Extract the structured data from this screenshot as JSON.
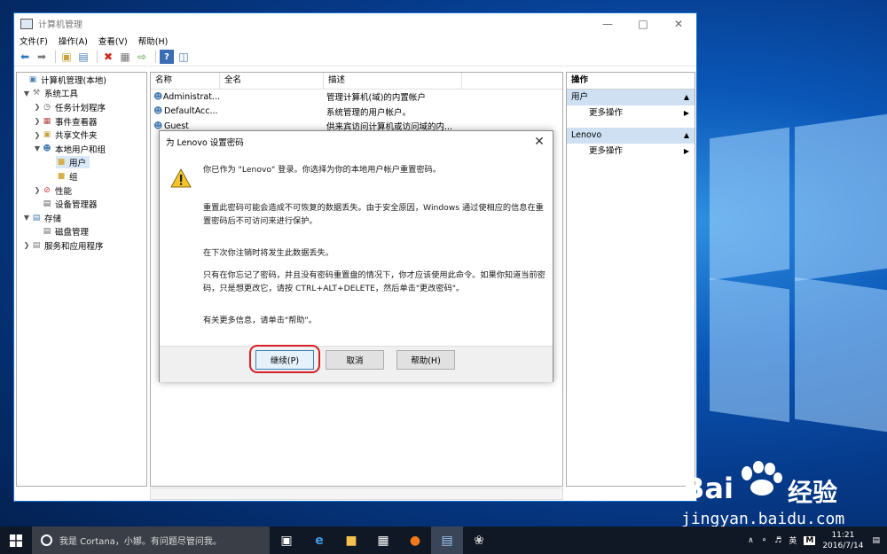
{
  "window": {
    "title": "计算机管理",
    "menu": [
      "文件(F)",
      "操作(A)",
      "查看(V)",
      "帮助(H)"
    ]
  },
  "tree": {
    "items": [
      {
        "label": "计算机管理(本地)",
        "icon": "computer-management-icon"
      },
      {
        "label": "系统工具",
        "icon": "system-tools-icon"
      },
      {
        "label": "任务计划程序",
        "icon": "task-scheduler-icon"
      },
      {
        "label": "事件查看器",
        "icon": "event-viewer-icon"
      },
      {
        "label": "共享文件夹",
        "icon": "shared-folders-icon"
      },
      {
        "label": "本地用户和组",
        "icon": "local-users-groups-icon"
      },
      {
        "label": "用户",
        "icon": "folder-icon"
      },
      {
        "label": "组",
        "icon": "folder-icon"
      },
      {
        "label": "性能",
        "icon": "performance-icon"
      },
      {
        "label": "设备管理器",
        "icon": "device-manager-icon"
      },
      {
        "label": "存储",
        "icon": "storage-icon"
      },
      {
        "label": "磁盘管理",
        "icon": "disk-management-icon"
      },
      {
        "label": "服务和应用程序",
        "icon": "services-apps-icon"
      }
    ]
  },
  "list": {
    "columns": [
      "名称",
      "全名",
      "描述"
    ],
    "rows": [
      {
        "name": "Administrat...",
        "fullname": "",
        "desc": "管理计算机(域)的内置帐户"
      },
      {
        "name": "DefaultAcc...",
        "fullname": "",
        "desc": "系统管理的用户帐户。"
      },
      {
        "name": "Guest",
        "fullname": "",
        "desc": "供来宾访问计算机或访问域的内..."
      }
    ]
  },
  "actions": {
    "header": "操作",
    "sections": [
      {
        "title": "用户",
        "item": "更多操作"
      },
      {
        "title": "Lenovo",
        "item": "更多操作"
      }
    ]
  },
  "dialog": {
    "title": "为 Lenovo 设置密码",
    "p1": "你已作为 \"Lenovo\" 登录。你选择为你的本地用户帐户重置密码。",
    "p2": "重置此密码可能会造成不可恢复的数据丢失。由于安全原因，Windows 通过使相应的信息在重置密码后不可访问来进行保护。",
    "p3": "在下次你注销时将发生此数据丢失。",
    "p4": "只有在你忘记了密码，并且没有密码重置盘的情况下，你才应该使用此命令。如果你知道当前密码，只是想更改它，请按 CTRL+ALT+DELETE，然后单击\"更改密码\"。",
    "p5": "有关更多信息，请单击\"帮助\"。",
    "btn_continue": "继续(P)",
    "btn_cancel": "取消",
    "btn_help": "帮助(H)"
  },
  "taskbar": {
    "search_placeholder": "我是 Cortana，小娜。有问题尽管问我。",
    "ime": "英",
    "time": "11:21",
    "date": "2016/7/14"
  },
  "watermark": {
    "brand": "Bai",
    "brand2": "经验",
    "url": "jingyan.baidu.com"
  },
  "colors": {
    "accent": "#1a6fc9",
    "highlight": "#d61f26",
    "selection": "#d9e8f7"
  }
}
